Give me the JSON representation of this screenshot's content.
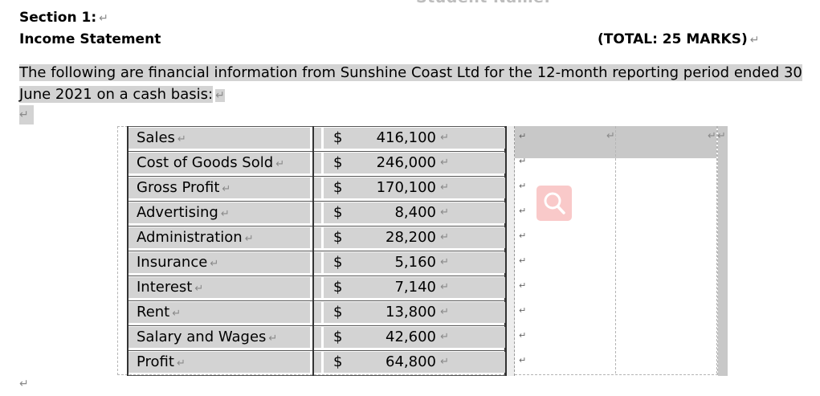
{
  "header": {
    "cutoff_text": "Student Name:",
    "section_label": "Section 1:",
    "title": "Income Statement",
    "marks": "(TOTAL:  25 MARKS)"
  },
  "intro": {
    "text": "The following are financial information from Sunshine Coast Ltd for the 12-month reporting period ended 30 June 2021 on a cash basis:"
  },
  "pilcrow": "↵",
  "currency": "$",
  "table": {
    "rows": [
      {
        "label": "Sales",
        "amount": "416,100"
      },
      {
        "label": "Cost of Goods Sold",
        "amount": "246,000"
      },
      {
        "label": "Gross Profit",
        "amount": "170,100"
      },
      {
        "label": "Advertising",
        "amount": "8,400"
      },
      {
        "label": "Administration",
        "amount": "28,200"
      },
      {
        "label": "Insurance",
        "amount": "5,160"
      },
      {
        "label": "Interest",
        "amount": "7,140"
      },
      {
        "label": "Rent",
        "amount": "13,800"
      },
      {
        "label": "Salary and Wages",
        "amount": "42,600"
      },
      {
        "label": "Profit",
        "amount": "64,800"
      }
    ]
  }
}
